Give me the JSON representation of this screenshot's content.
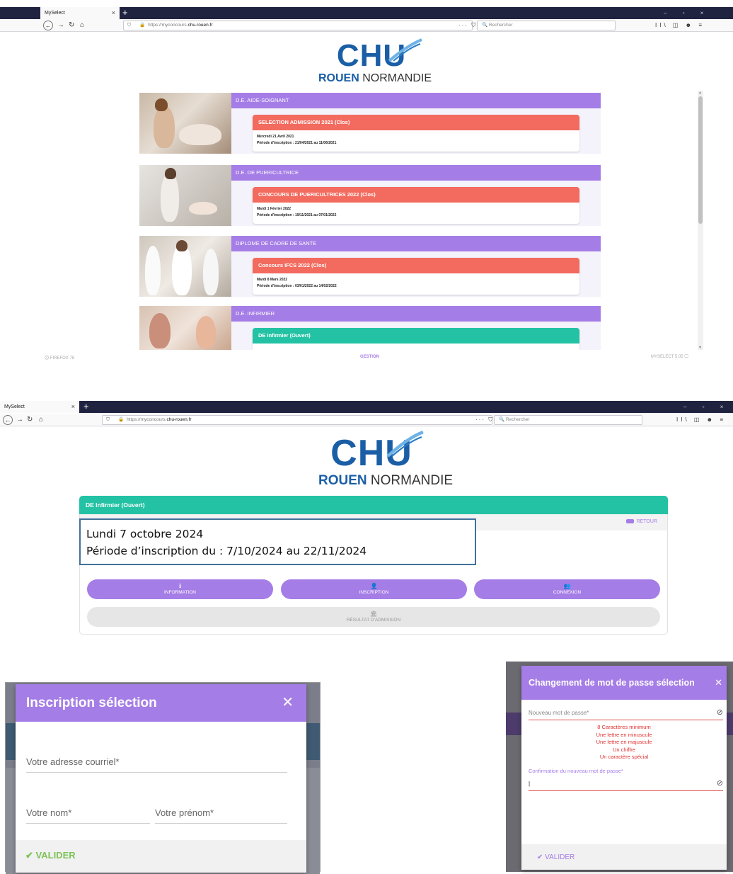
{
  "browser": {
    "tab_title": "MySelect",
    "tab_close": "×",
    "new_tab": "+",
    "url_prefix": "https://myconcours.",
    "url_domain": "chu-rouen.fr",
    "search_placeholder": "Rechercher",
    "page_actions": "··· ⛉ ☆",
    "tools": "II\\ ◫ ☻ ≡",
    "win_controls": "–  ▫  ×"
  },
  "logo": {
    "chu": "CHU",
    "rouen": "ROUEN",
    "normandie": " NORMANDIE"
  },
  "listing": {
    "cards": [
      {
        "category": "D.E. AIDE-SOIGNANT",
        "status": "closed",
        "title": "SELECTION ADMISSION 2021 (Clos)",
        "date": "Mercredi 21 Avril 2021",
        "period": "Période d'inscription : 21/04/2021 au 11/06/2021"
      },
      {
        "category": "D.E. DE PUERICULTRICE",
        "status": "closed",
        "title": "CONCOURS DE PUERICULTRICES 2022 (Clos)",
        "date": "Mardi 1 Février 2022",
        "period": "Période d'inscription : 19/11/2021 au 07/01/2022"
      },
      {
        "category": "DIPLOME DE CADRE DE SANTE",
        "status": "closed",
        "title": "Concours IFCS 2022 (Clos)",
        "date": "Mardi 8 Mars 2022",
        "period": "Période d'inscription : 03/01/2022 au 14/02/2022"
      },
      {
        "category": "D.E. INFIRMIER",
        "status": "open",
        "title": "DE Infirmier (Ouvert)",
        "date": "",
        "period": ""
      }
    ],
    "footer_left": "FIREFOX 78",
    "footer_center": "GESTION",
    "footer_right": "MYSELECT 5.05"
  },
  "detail": {
    "title": "DE Infirmier (Ouvert)",
    "retour": "RETOUR",
    "callout_date": "Lundi 7 octobre 2024",
    "callout_period": "Période d’inscription du : 7/10/2024 au 22/11/2024",
    "buttons": [
      {
        "icon": "ℹ",
        "label": "INFORMATION"
      },
      {
        "icon": "👤",
        "label": "INSCRIPTION"
      },
      {
        "icon": "👥",
        "label": "CONNEXION"
      }
    ],
    "result_icon": "🏛",
    "result_label": "RÉSULTAT D'ADMISSION"
  },
  "inscription_modal": {
    "title": "Inscription sélection",
    "close": "✕",
    "email_placeholder": "Votre adresse courriel*",
    "lastname_placeholder": "Votre nom*",
    "firstname_placeholder": "Votre prénom*",
    "submit": "VALIDER",
    "submit_icon": "✔"
  },
  "password_modal": {
    "title": "Changement de mot de passe sélection",
    "close": "✕",
    "new_password_placeholder": "Nouveau mot de passe*",
    "rules": [
      "8 Caractères minimum",
      "Une lettre en minuscule",
      "Une lettre en majuscule",
      "Un chiffre",
      "Un caractère spécial"
    ],
    "confirm_label": "Confirmation du nouveau mot de passe*",
    "confirm_value": "|",
    "submit": "VALIDER",
    "submit_icon": "✔",
    "eye_icon": "⊘"
  },
  "colors": {
    "purple": "#a57de6",
    "teal": "#23c2a4",
    "coral": "#f36a5e",
    "chu_blue": "#1a5ea6",
    "valid_green": "#7cc356",
    "error_red": "#e02e2e"
  }
}
